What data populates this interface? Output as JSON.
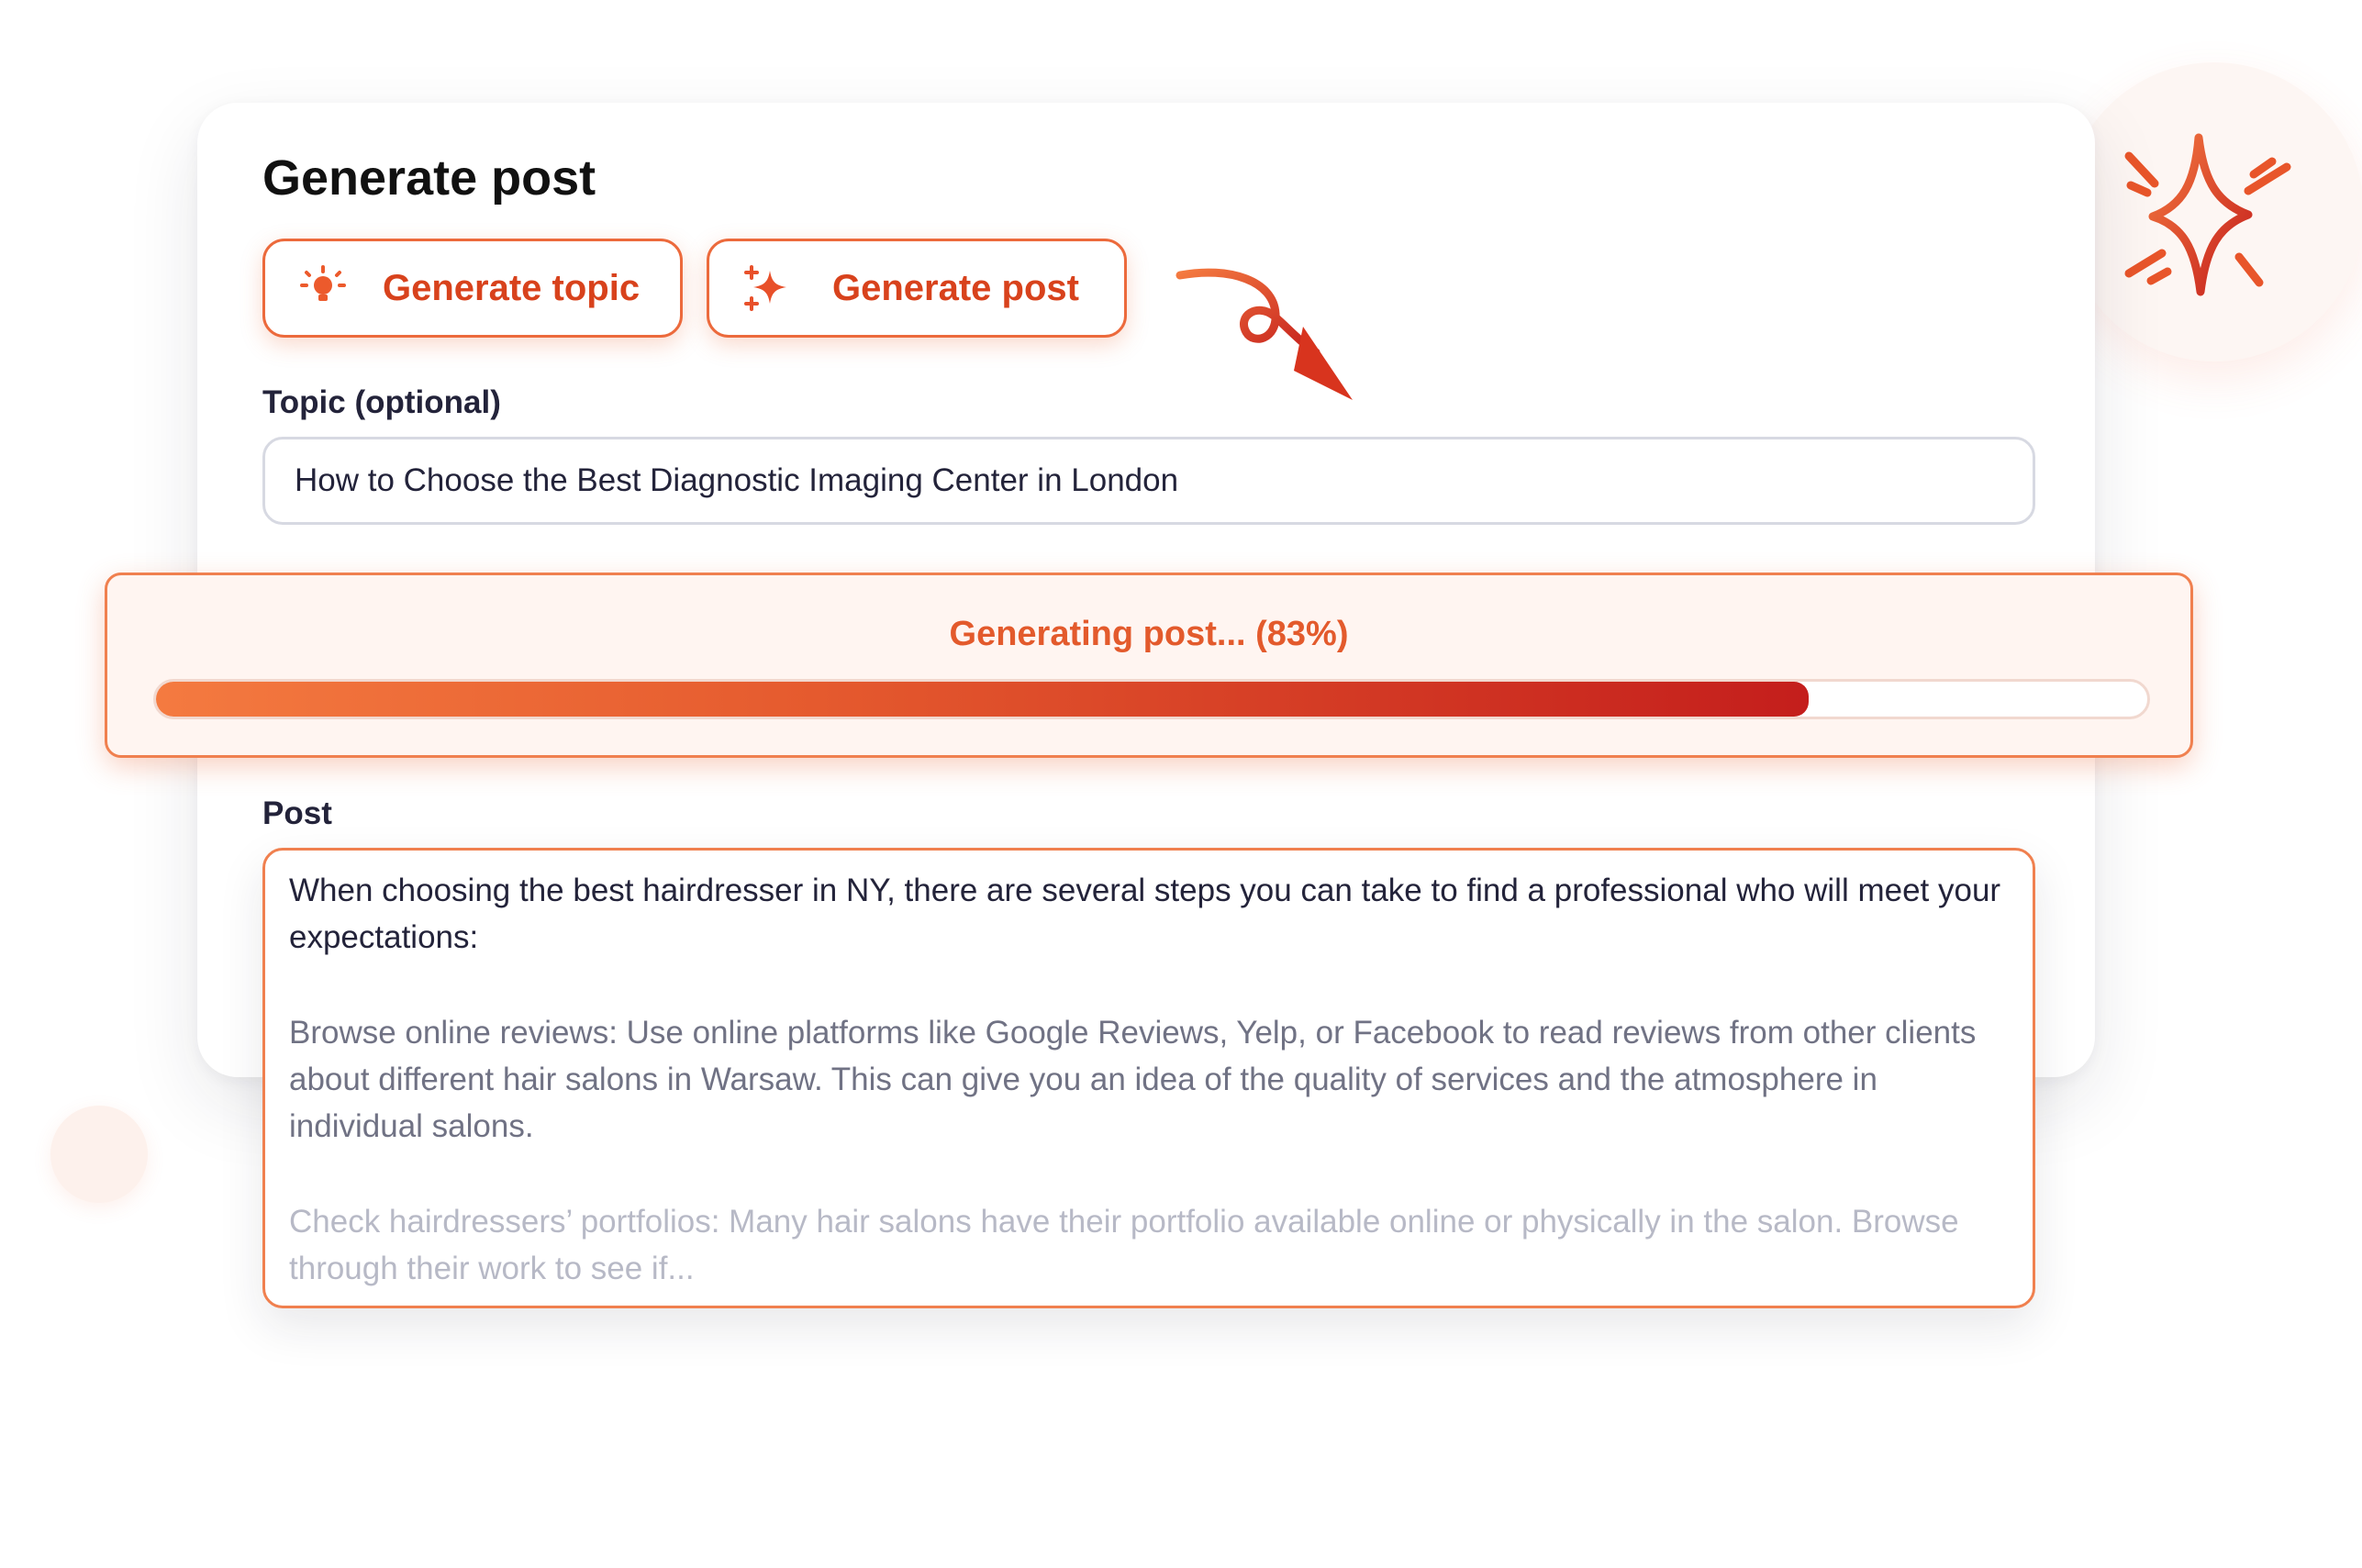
{
  "card": {
    "title": "Generate post"
  },
  "buttons": {
    "generate_topic": {
      "label": "Generate topic",
      "icon": "lightbulb-icon"
    },
    "generate_post": {
      "label": "Generate post",
      "icon": "sparkles-icon"
    }
  },
  "topic": {
    "label": "Topic (optional)",
    "value": "How to Choose the Best Diagnostic Imaging Center in London"
  },
  "progress": {
    "text": "Generating post... (83%)",
    "value": 0.83
  },
  "post": {
    "label": "Post",
    "paragraphs": [
      "When choosing the best hairdresser in NY, there are several steps you can take to find a professional who will meet your expectations:",
      "Browse online reviews: Use online platforms like Google Reviews, Yelp, or Facebook to read reviews from other clients about different hair salons in Warsaw. This can give you an idea of the quality of services and the atmosphere in individual salons.",
      "Check hairdressers’ portfolios: Many hair salons have their portfolio available online or physically in the salon. Browse through their work to see if..."
    ]
  },
  "decorations": {
    "big_sparkle": "sparkle-icon",
    "arrow": "curly-arrow-icon"
  },
  "colors": {
    "accent": "#ec6a3c",
    "accent_dark": "#c41e1c",
    "text_dark": "#23233a"
  }
}
